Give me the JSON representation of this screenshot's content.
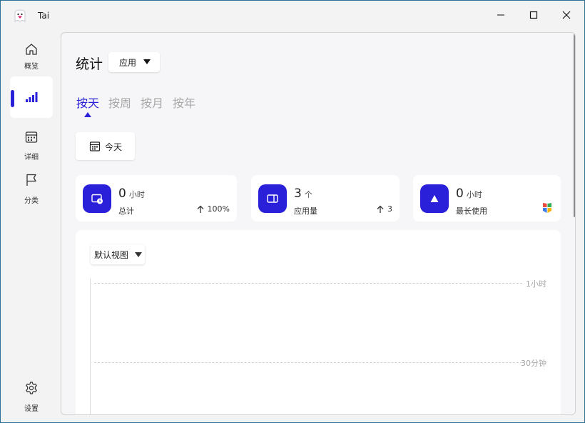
{
  "app": {
    "title": "Tai"
  },
  "sidebar": {
    "items": [
      {
        "label": "概览",
        "icon": "home-icon"
      },
      {
        "label": "",
        "icon": "bar-chart-icon"
      },
      {
        "label": "详细",
        "icon": "calendar-icon"
      },
      {
        "label": "分类",
        "icon": "flag-icon"
      }
    ],
    "settings_label": "设置"
  },
  "header": {
    "title": "统计",
    "scope_select": "应用"
  },
  "tabs": [
    "按天",
    "按周",
    "按月",
    "按年"
  ],
  "active_tab": "按天",
  "date_button": {
    "label": "今天"
  },
  "stats": [
    {
      "value": "0",
      "unit": "小时",
      "caption": "总计",
      "trend": "100%",
      "icon": "clock-window-icon"
    },
    {
      "value": "3",
      "unit": "个",
      "caption": "应用量",
      "trend": "3",
      "icon": "app-window-icon"
    },
    {
      "value": "0",
      "unit": "小时",
      "caption": "最长使用",
      "trend": "",
      "icon": "triangle-up-icon"
    }
  ],
  "chart": {
    "view_select": "默认视图",
    "y_labels": [
      "1小时",
      "30分钟"
    ]
  },
  "colors": {
    "accent": "#2b20d9",
    "background": "#f3f3f3",
    "card": "#ffffff"
  }
}
